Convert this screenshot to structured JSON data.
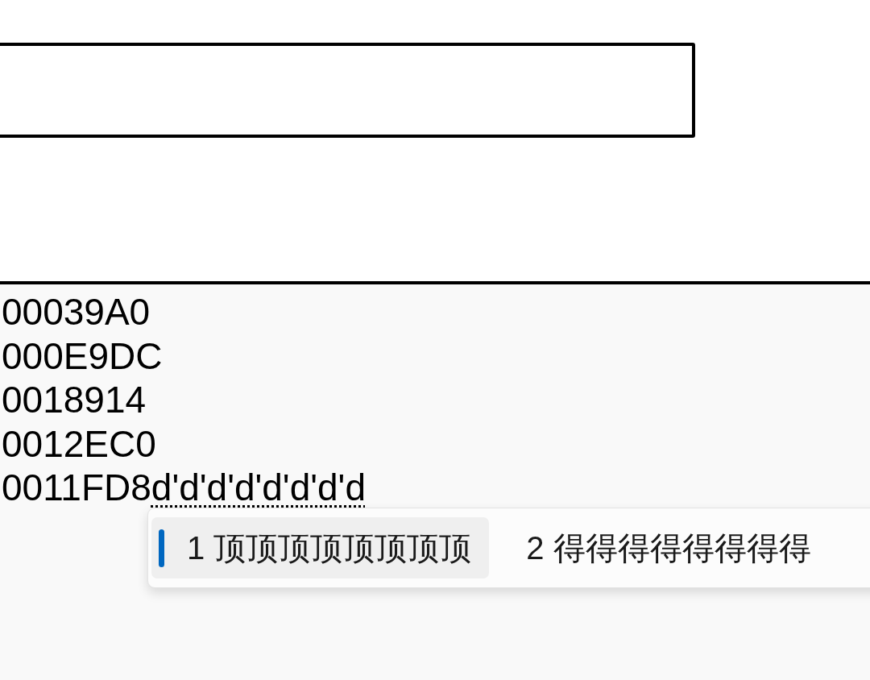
{
  "input_field": {
    "kind": "text"
  },
  "editor": {
    "lines": [
      "00039A0",
      "000E9DC",
      "0018914",
      "0012EC0",
      "0011FD8"
    ],
    "composition": "d'd'd'd'd'd'd'd"
  },
  "candidates": [
    {
      "index": "1",
      "text": "顶顶顶顶顶顶顶顶",
      "selected": true
    },
    {
      "index": "2",
      "text": "得得得得得得得得",
      "selected": false
    }
  ]
}
